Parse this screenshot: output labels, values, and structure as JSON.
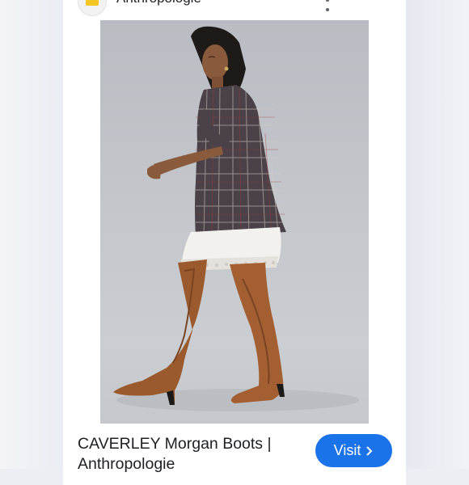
{
  "site": {
    "name": "Anthropologie"
  },
  "image": {
    "icon": "product-photo"
  },
  "result": {
    "title": "CAVERLEY Morgan Boots | Anthropologie"
  },
  "visit_button": {
    "label": "Visit",
    "color": "#1a73e8"
  },
  "icons": {
    "favicon": "site-favicon-icon",
    "more": "more-vert-icon",
    "close": "close-icon",
    "chevron": "chevron-right-icon"
  }
}
